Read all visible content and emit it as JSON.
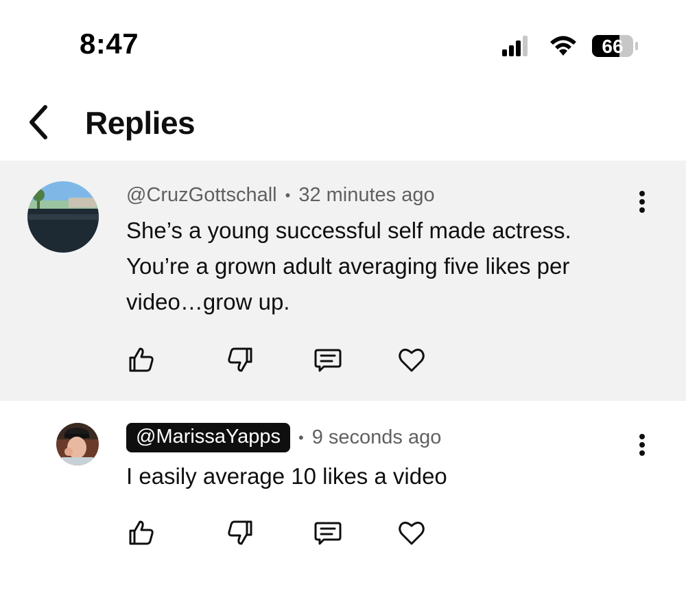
{
  "status_bar": {
    "time": "8:47",
    "battery_level": "66",
    "signal_icon": "cellular-signal-icon",
    "wifi_icon": "wifi-icon",
    "battery_icon": "battery-icon"
  },
  "header": {
    "title": "Replies",
    "back_icon": "chevron-left-icon"
  },
  "comments": [
    {
      "handle": "@CruzGottschall",
      "time_ago": "32 minutes ago",
      "text": "She’s a young successful self made actress.\nYou’re a grown adult averaging five likes per\nvideo…grow up.",
      "highlighted_handle": false,
      "actions": [
        "thumbs-up-icon",
        "thumbs-down-icon",
        "reply-comment-icon",
        "heart-icon"
      ],
      "menu_icon": "more-vertical-icon"
    },
    {
      "handle": "@MarissaYapps",
      "time_ago": "9 seconds ago",
      "text": "I easily average 10 likes a video",
      "highlighted_handle": true,
      "actions": [
        "thumbs-up-icon",
        "thumbs-down-icon",
        "reply-comment-icon",
        "heart-icon"
      ],
      "menu_icon": "more-vertical-icon"
    }
  ],
  "colors": {
    "highlight_background": "#f2f2f2",
    "text_primary": "#0f0f0f",
    "text_secondary": "#606060",
    "handle_chip_background": "#0f0f0f",
    "handle_chip_text": "#ffffff"
  },
  "separator": "•"
}
